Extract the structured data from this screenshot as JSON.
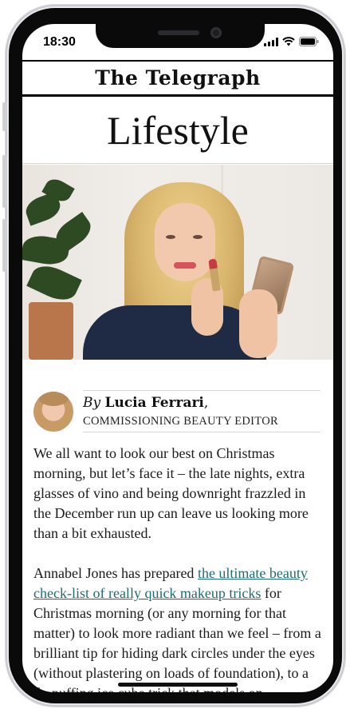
{
  "status_bar": {
    "time": "18:30"
  },
  "header": {
    "masthead": "The Telegraph",
    "section": "Lifestyle"
  },
  "author": {
    "by": "By",
    "name": "Lucia Ferrari",
    "comma": ",",
    "role": "COMMISSIONING BEAUTY EDITOR"
  },
  "article": {
    "p1": "We all want to look our best on Christmas morning, but let’s face it – the late nights, extra glasses of vino and being downright frazzled in the December run up can leave us looking more than a bit exhausted.",
    "p2_before": "Annabel Jones has prepared ",
    "p2_link": "the ultimate beauty check-list of really quick makeup tricks",
    "p2_after": " for Christmas morning (or any morning for that matter) to look more radiant than we feel – from a brilliant tip for hiding dark circles under the eyes (without plastering on loads of foundation), to a de-puffing ice cube trick that models on"
  },
  "colors": {
    "link": "#1e6b74",
    "text": "#1a1a1a"
  },
  "icons": [
    "signal-icon",
    "wifi-icon",
    "battery-icon"
  ]
}
